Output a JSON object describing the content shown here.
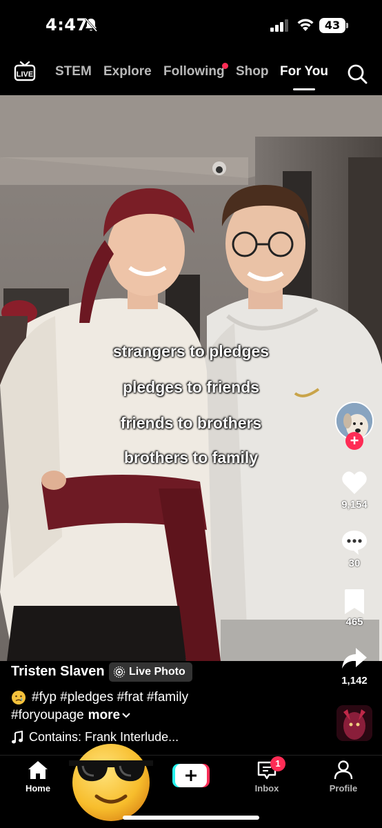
{
  "status_bar": {
    "time": "4:47",
    "battery": "43"
  },
  "top_nav": {
    "tabs": [
      {
        "label": "STEM",
        "active": false
      },
      {
        "label": "Explore",
        "active": false
      },
      {
        "label": "Following",
        "active": false,
        "has_dot": true
      },
      {
        "label": "Shop",
        "active": false
      },
      {
        "label": "For You",
        "active": true
      }
    ]
  },
  "video": {
    "caption_lines": [
      "strangers to pledges",
      "pledges to friends",
      "friends to brothers",
      "brothers to family"
    ]
  },
  "actions": {
    "likes": "9,154",
    "comments": "30",
    "saves": "465",
    "shares": "1,142"
  },
  "post": {
    "username": "Tristen Slaven",
    "badge": "Live Photo",
    "hashtags_line1": "#fyp #pledges #frat #family",
    "hashtags_line2": "#foryoupage",
    "more": "more",
    "sound": "Contains: Frank Interlude..."
  },
  "tab_bar": {
    "home": "Home",
    "inbox": "Inbox",
    "inbox_badge": "1",
    "profile": "Profile"
  },
  "colors": {
    "accent": "#fe2c55",
    "cyan": "#25f4ee"
  }
}
